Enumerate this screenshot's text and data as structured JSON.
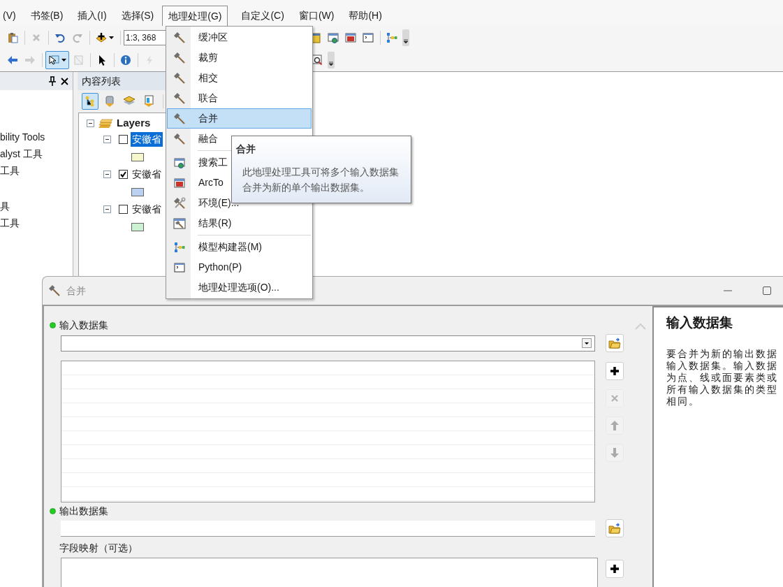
{
  "menu_bar": [
    {
      "label": "(V)",
      "open": false
    },
    {
      "label": "书签(B)",
      "open": false
    },
    {
      "label": "插入(I)",
      "open": false
    },
    {
      "label": "选择(S)",
      "open": false
    },
    {
      "label": "地理处理(G)",
      "open": true
    },
    {
      "label": "自定义(C)",
      "open": false
    },
    {
      "label": "窗口(W)",
      "open": false
    },
    {
      "label": "帮助(H)",
      "open": false
    }
  ],
  "standard_toolbar": {
    "left_groups": [
      [
        {
          "kind": "paste",
          "disabled": false
        }
      ],
      [
        {
          "kind": "delete",
          "disabled": true
        }
      ],
      [
        {
          "kind": "undo",
          "disabled": false
        },
        {
          "kind": "redo",
          "disabled": true
        }
      ],
      [
        {
          "kind": "add-data",
          "disabled": false,
          "menu": true
        }
      ]
    ],
    "scale": "1:3, 368",
    "right_groups": [
      [
        {
          "kind": "catalog",
          "disabled": false
        },
        {
          "kind": "search-window",
          "disabled": false
        },
        {
          "kind": "toolbox",
          "disabled": false
        },
        {
          "kind": "python-window",
          "disabled": false
        }
      ],
      [
        {
          "kind": "model-builder",
          "disabled": false
        }
      ]
    ]
  },
  "tools_toolbar": {
    "left_groups": [
      [
        {
          "kind": "back",
          "disabled": false,
          "pressed": false
        },
        {
          "kind": "forward",
          "disabled": true,
          "pressed": false
        }
      ],
      [
        {
          "kind": "select-features",
          "disabled": false,
          "pressed": true,
          "menu": true
        },
        {
          "kind": "clear-selection",
          "disabled": true,
          "pressed": false
        }
      ],
      [
        {
          "kind": "pointer",
          "disabled": false,
          "pressed": false
        }
      ],
      [
        {
          "kind": "info",
          "disabled": false,
          "pressed": false
        }
      ],
      [
        {
          "kind": "lightning",
          "disabled": true,
          "pressed": false
        }
      ]
    ],
    "right_groups": [
      [
        {
          "kind": "zoom-window",
          "disabled": false,
          "pressed": false
        }
      ]
    ]
  },
  "arctoolbox_panel": {
    "groups": [
      [
        "bility Tools",
        "alyst 工具",
        "工具"
      ],
      [
        "具",
        "工具"
      ]
    ]
  },
  "table_of_contents": {
    "title": "内容列表",
    "tools": [
      {
        "kind": "list-by-drawing-order",
        "selected": true
      },
      {
        "kind": "list-by-source",
        "selected": false
      },
      {
        "kind": "list-by-visibility",
        "selected": false
      },
      {
        "kind": "list-by-selection",
        "selected": false
      }
    ],
    "root": {
      "label": "Layers",
      "expanded": true,
      "children": [
        {
          "label": "安徽省",
          "checked": false,
          "selected": true,
          "expanded": true,
          "color": "#f7f7cc"
        },
        {
          "label": "安徽省",
          "checked": true,
          "selected": false,
          "expanded": true,
          "color": "#bcd0f2"
        },
        {
          "label": "安徽省",
          "checked": false,
          "selected": false,
          "expanded": true,
          "color": "#cdf2d2"
        }
      ]
    }
  },
  "geoprocessing_menu": {
    "groups": [
      [
        {
          "label": "缓冲区",
          "kind": "hammer",
          "selected": false
        },
        {
          "label": "裁剪",
          "kind": "hammer",
          "selected": false
        },
        {
          "label": "相交",
          "kind": "hammer",
          "selected": false
        },
        {
          "label": "联合",
          "kind": "hammer",
          "selected": false
        },
        {
          "label": "合并",
          "kind": "hammer",
          "selected": true
        },
        {
          "label": "融合",
          "kind": "hammer",
          "selected": false
        }
      ],
      [
        {
          "label": "搜索工",
          "kind": "search-window",
          "selected": false
        },
        {
          "label": "ArcTo",
          "kind": "toolbox",
          "selected": false
        },
        {
          "label": "环境(E)...",
          "kind": "environment",
          "selected": false
        },
        {
          "label": "结果(R)",
          "kind": "results",
          "selected": false
        }
      ],
      [
        {
          "label": "模型构建器(M)",
          "kind": "model-builder",
          "selected": false
        },
        {
          "label": "Python(P)",
          "kind": "python-window",
          "selected": false
        },
        {
          "label": "地理处理选项(O)...",
          "kind": "none",
          "selected": false
        }
      ]
    ]
  },
  "tooltip": {
    "title": "合并",
    "text": "此地理处理工具可将多个输入数据集合并为新的单个输出数据集。"
  },
  "dialog": {
    "title": "合并",
    "parameters": [
      {
        "label": "输入数据集",
        "required": true,
        "kind": "multivalue",
        "buttons": [
          {
            "kind": "plus",
            "disabled": false
          },
          {
            "kind": "remove",
            "disabled": true
          },
          {
            "kind": "move-up",
            "disabled": true
          },
          {
            "kind": "move-down",
            "disabled": true
          }
        ]
      },
      {
        "label": "输出数据集",
        "required": true,
        "kind": "output"
      },
      {
        "label": "字段映射（可选）",
        "required": false,
        "kind": "field-map"
      }
    ],
    "help": {
      "title": "输入数据集",
      "lines": [
        "要合并为新的输出数据",
        "输入数据集。输入数据",
        "为点、线或面要素类或",
        "所有输入数据集的类型",
        "相同。"
      ]
    }
  }
}
